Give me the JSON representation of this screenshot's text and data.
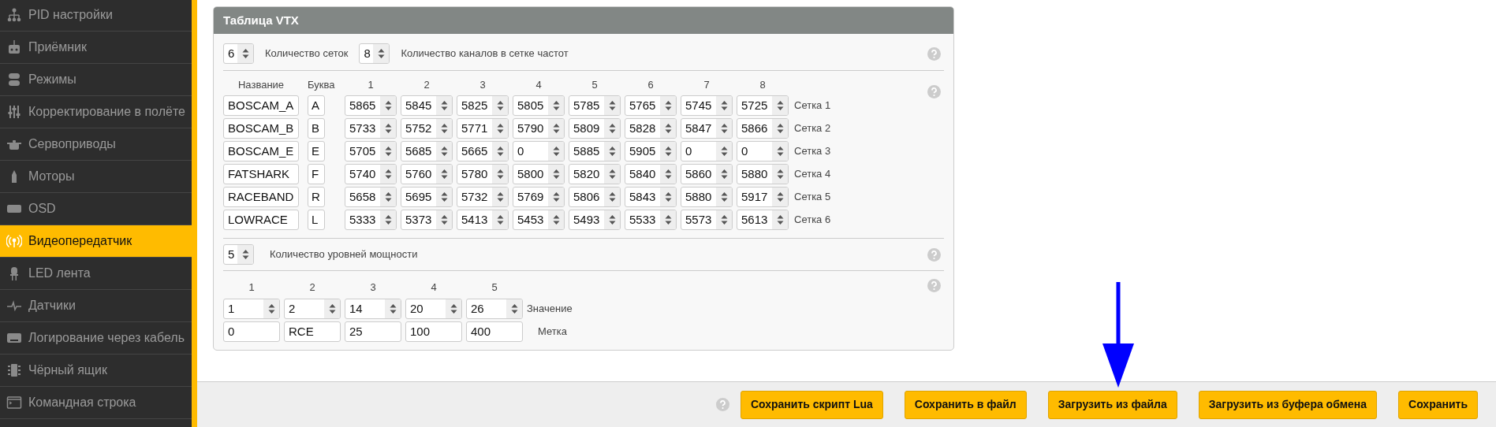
{
  "sidebar": {
    "items": [
      {
        "label": "PID настройки",
        "selected": false
      },
      {
        "label": "Приёмник",
        "selected": false
      },
      {
        "label": "Режимы",
        "selected": false
      },
      {
        "label": "Корректирование в полёте",
        "selected": false
      },
      {
        "label": "Сервоприводы",
        "selected": false
      },
      {
        "label": "Моторы",
        "selected": false
      },
      {
        "label": "OSD",
        "selected": false
      },
      {
        "label": "Видеопередатчик",
        "selected": true
      },
      {
        "label": "LED лента",
        "selected": false
      },
      {
        "label": "Датчики",
        "selected": false
      },
      {
        "label": "Логирование через кабель",
        "selected": false
      },
      {
        "label": "Чёрный ящик",
        "selected": false
      },
      {
        "label": "Командная строка",
        "selected": false
      }
    ]
  },
  "vtx_table": {
    "title": "Таблица VTX",
    "bands_count": {
      "value": "6",
      "label": "Количество сеток"
    },
    "channels_count": {
      "value": "8",
      "label": "Количество каналов в сетке частот"
    },
    "columns": [
      "Название",
      "Буква",
      "1",
      "2",
      "3",
      "4",
      "5",
      "6",
      "7",
      "8"
    ],
    "bands": [
      {
        "name": "BOSCAM_A",
        "letter": "A",
        "frequencies": [
          "5865",
          "5845",
          "5825",
          "5805",
          "5785",
          "5765",
          "5745",
          "5725"
        ],
        "label": "Сетка 1"
      },
      {
        "name": "BOSCAM_B",
        "letter": "B",
        "frequencies": [
          "5733",
          "5752",
          "5771",
          "5790",
          "5809",
          "5828",
          "5847",
          "5866"
        ],
        "label": "Сетка 2"
      },
      {
        "name": "BOSCAM_E",
        "letter": "E",
        "frequencies": [
          "5705",
          "5685",
          "5665",
          "0",
          "5885",
          "5905",
          "0",
          "0"
        ],
        "label": "Сетка 3"
      },
      {
        "name": "FATSHARK",
        "letter": "F",
        "frequencies": [
          "5740",
          "5760",
          "5780",
          "5800",
          "5820",
          "5840",
          "5860",
          "5880"
        ],
        "label": "Сетка 4"
      },
      {
        "name": "RACEBAND",
        "letter": "R",
        "frequencies": [
          "5658",
          "5695",
          "5732",
          "5769",
          "5806",
          "5843",
          "5880",
          "5917"
        ],
        "label": "Сетка 5"
      },
      {
        "name": "LOWRACE",
        "letter": "L",
        "frequencies": [
          "5333",
          "5373",
          "5413",
          "5453",
          "5493",
          "5533",
          "5573",
          "5613"
        ],
        "label": "Сетка 6"
      }
    ],
    "power_count": {
      "value": "5",
      "label": "Количество уровней мощности"
    },
    "power_columns": [
      "1",
      "2",
      "3",
      "4",
      "5"
    ],
    "power_values": [
      "1",
      "2",
      "14",
      "20",
      "26"
    ],
    "power_values_label": "Значение",
    "power_labels": [
      "0",
      "RCE",
      "25",
      "100",
      "400"
    ],
    "power_labels_label": "Метка"
  },
  "footer": {
    "buttons": [
      "Сохранить скрипт Lua",
      "Сохранить в файл",
      "Загрузить из файла",
      "Загрузить из буфера обмена",
      "Сохранить"
    ]
  }
}
